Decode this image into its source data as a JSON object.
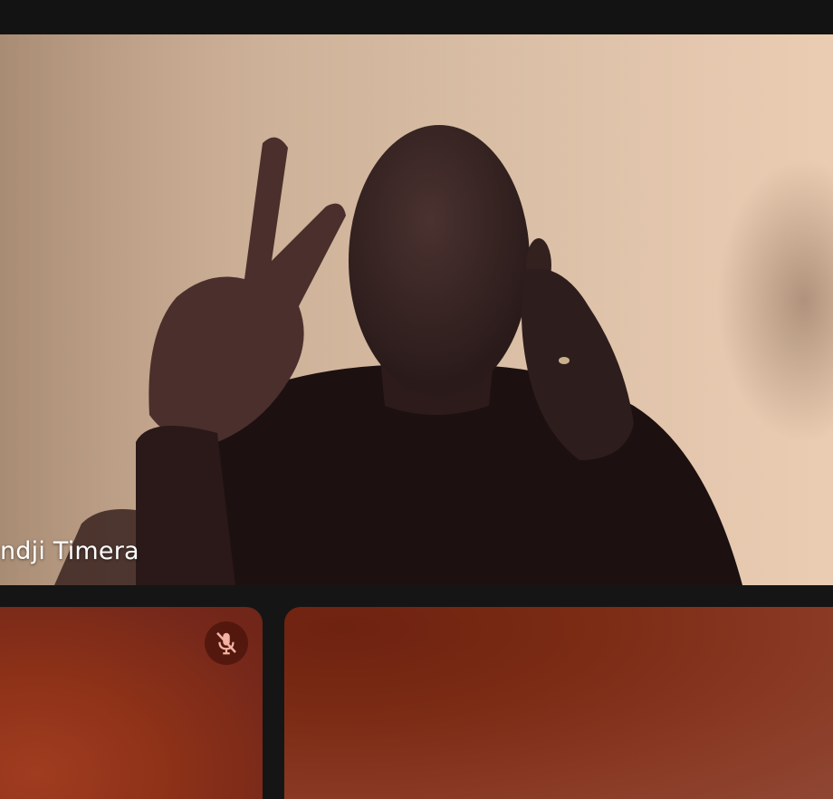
{
  "main_tile": {
    "participant_name": "ndji Timera"
  },
  "tiles": [
    {
      "id": "left",
      "mic_icon": "mic-off-icon",
      "muted": true
    },
    {
      "id": "right"
    }
  ],
  "colors": {
    "background": "#151515",
    "tile_left": "#8e3218",
    "tile_right": "#7c2c15",
    "mic_badge": "#46120a"
  }
}
